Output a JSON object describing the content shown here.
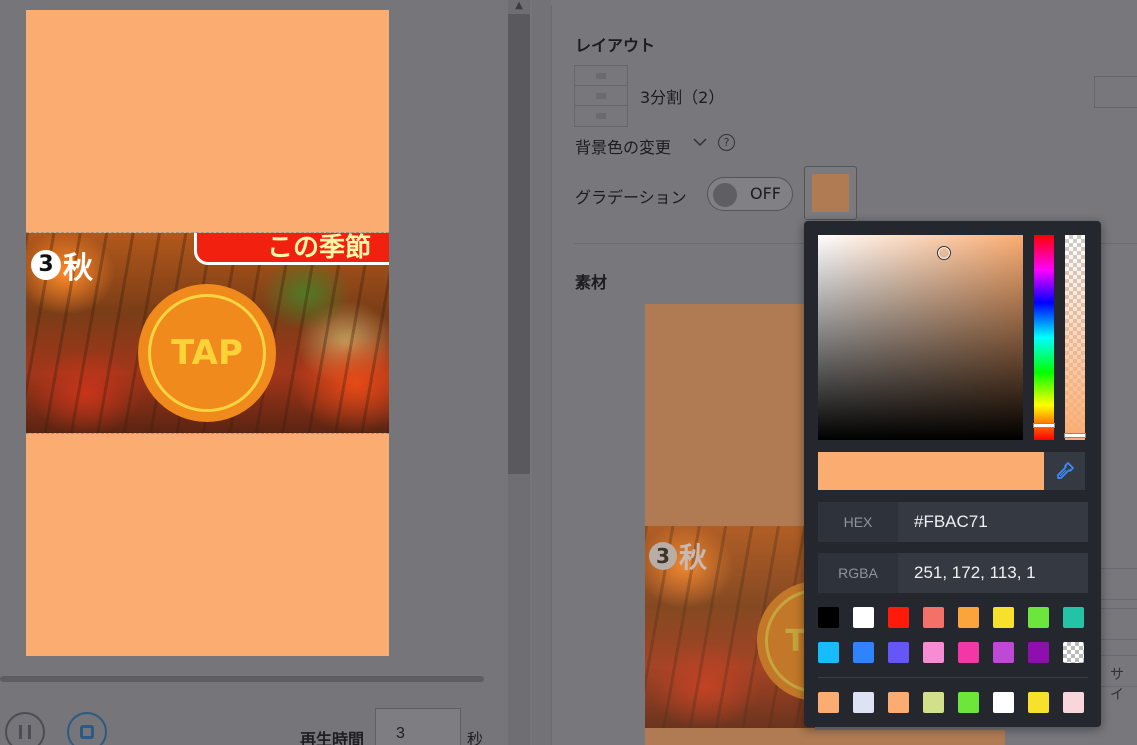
{
  "preview": {
    "background_color": "#FBAC71",
    "step_number": "3",
    "step_label": "秋",
    "banner_text": "この季節",
    "tap_label": "TAP"
  },
  "playback": {
    "duration_label": "再生時間",
    "duration_value": "3",
    "duration_unit": "秒"
  },
  "settings": {
    "layout_heading": "レイアウト",
    "layout_value": "3分割（2）",
    "bg_color_label": "背景色の変更",
    "help_icon_glyph": "?",
    "gradient_label": "グラデーション",
    "gradient_toggle_state": "OFF",
    "swatch_color": "#B07A52",
    "material_heading": "素材",
    "side_field_text": "サイ"
  },
  "color_picker": {
    "selected_color": "#FBAC71",
    "hex_label": "HEX",
    "hex_value": "#FBAC71",
    "rgba_label": "RGBA",
    "rgba_value": "251, 172, 113, 1",
    "presets_row1": [
      "#000000",
      "#FFFFFF",
      "#FF1A0A",
      "#F37167",
      "#FBA43C",
      "#F7E12A",
      "#6CE63A",
      "#23C4A6"
    ],
    "presets_row2": [
      "#17BCFF",
      "#2E84FF",
      "#6655F8",
      "#F78CD4",
      "#F238A6",
      "#C048D6",
      "#8E0EAE",
      "transparent"
    ],
    "recent_colors": [
      "#FBAC71",
      "#DDE3F5",
      "#FBAC71",
      "#D3E08B",
      "#6CE63A",
      "#FFFFFF",
      "#F7E12A",
      "#F8D6DC"
    ]
  }
}
